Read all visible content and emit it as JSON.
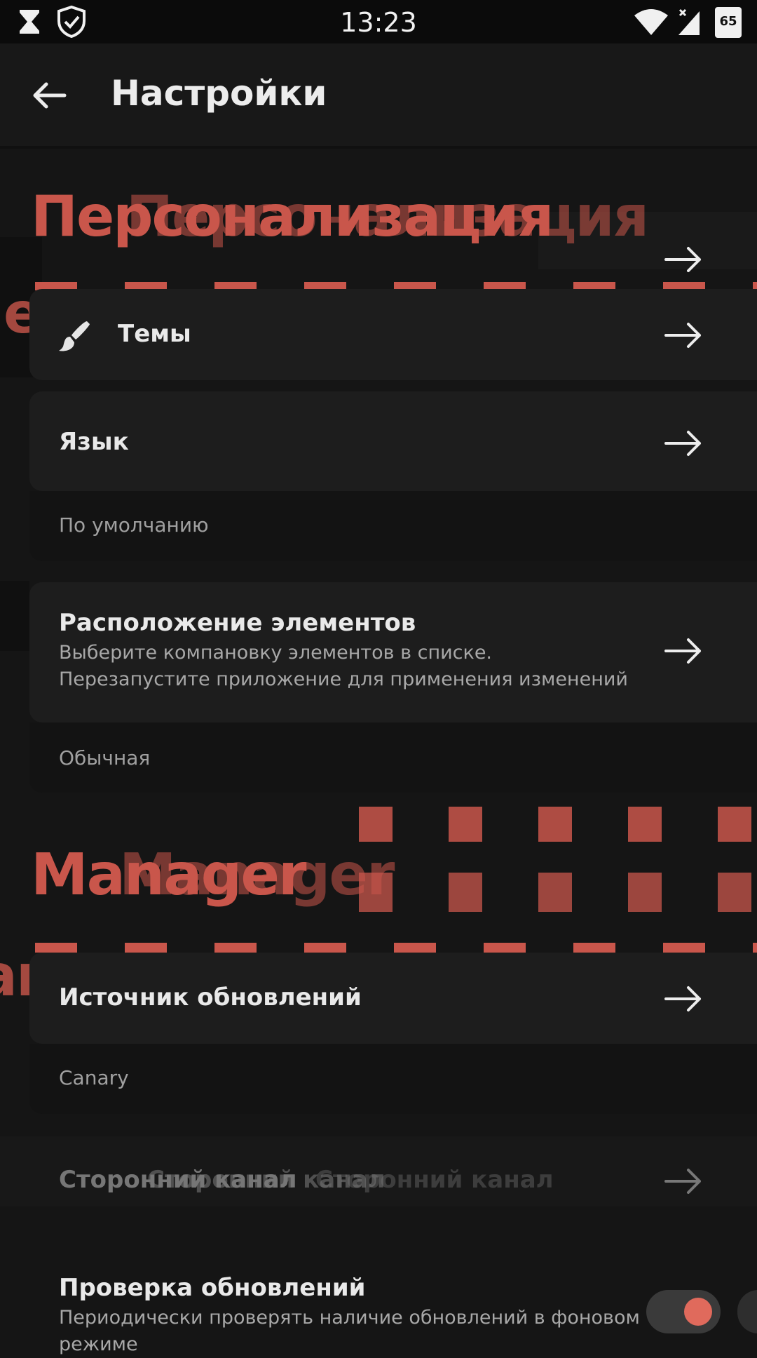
{
  "status_bar": {
    "time": "13:23",
    "battery": "65"
  },
  "app_bar": {
    "title": "Настройки"
  },
  "sections": {
    "personalization": "Персонализация",
    "manager": "Manager"
  },
  "settings": {
    "themes": {
      "title": "Темы"
    },
    "language": {
      "title": "Язык",
      "value": "По умолчанию"
    },
    "layout": {
      "title": "Расположение элементов",
      "description": "Выберите компановку элементов в списке. Перезапустите приложение для применения изменений",
      "value": "Обычная"
    },
    "update_source": {
      "title": "Источник обновлений",
      "value": "Canary"
    },
    "third_party_channel": {
      "title": "Сторонний канал"
    },
    "check_updates": {
      "title": "Проверка обновлений",
      "description": "Периодически проверять наличие обновлений в фоновом режиме",
      "enabled": true
    }
  },
  "colors": {
    "accent": "#e06a5c",
    "background": "#151515",
    "card": "#1d1d1d"
  },
  "icons": [
    "hourglass-icon",
    "shield-check-icon",
    "wifi-icon",
    "signal-icon",
    "battery-icon",
    "back-arrow-icon",
    "brush-icon",
    "arrow-right-icon"
  ]
}
